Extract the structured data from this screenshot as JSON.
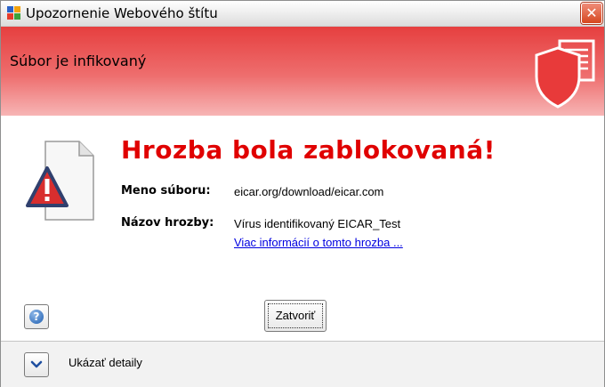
{
  "window": {
    "title": "Upozornenie Webového štítu",
    "close_glyph": "✕",
    "accent": "#e63f3f"
  },
  "header": {
    "title": "Súbor je infikovaný",
    "icon": "shield-icon"
  },
  "alert": {
    "headline": "Hrozba bola zablokovaná!",
    "icon": "warning-file-icon",
    "headline_color": "#e00000",
    "file_label": "Meno súboru:",
    "file_value": "eicar.org/download/eicar.com",
    "threat_label": "Názov hrozby:",
    "threat_value": "Vírus identifikovaný EICAR_Test",
    "more_info_link": "Viac informácií o tomto hrozba ..."
  },
  "buttons": {
    "help_glyph": "?",
    "help_icon": "help-icon",
    "close_label": "Zatvoriť"
  },
  "footer": {
    "expand_icon": "chevron-down-icon",
    "details_label": "Ukázať detaily"
  }
}
